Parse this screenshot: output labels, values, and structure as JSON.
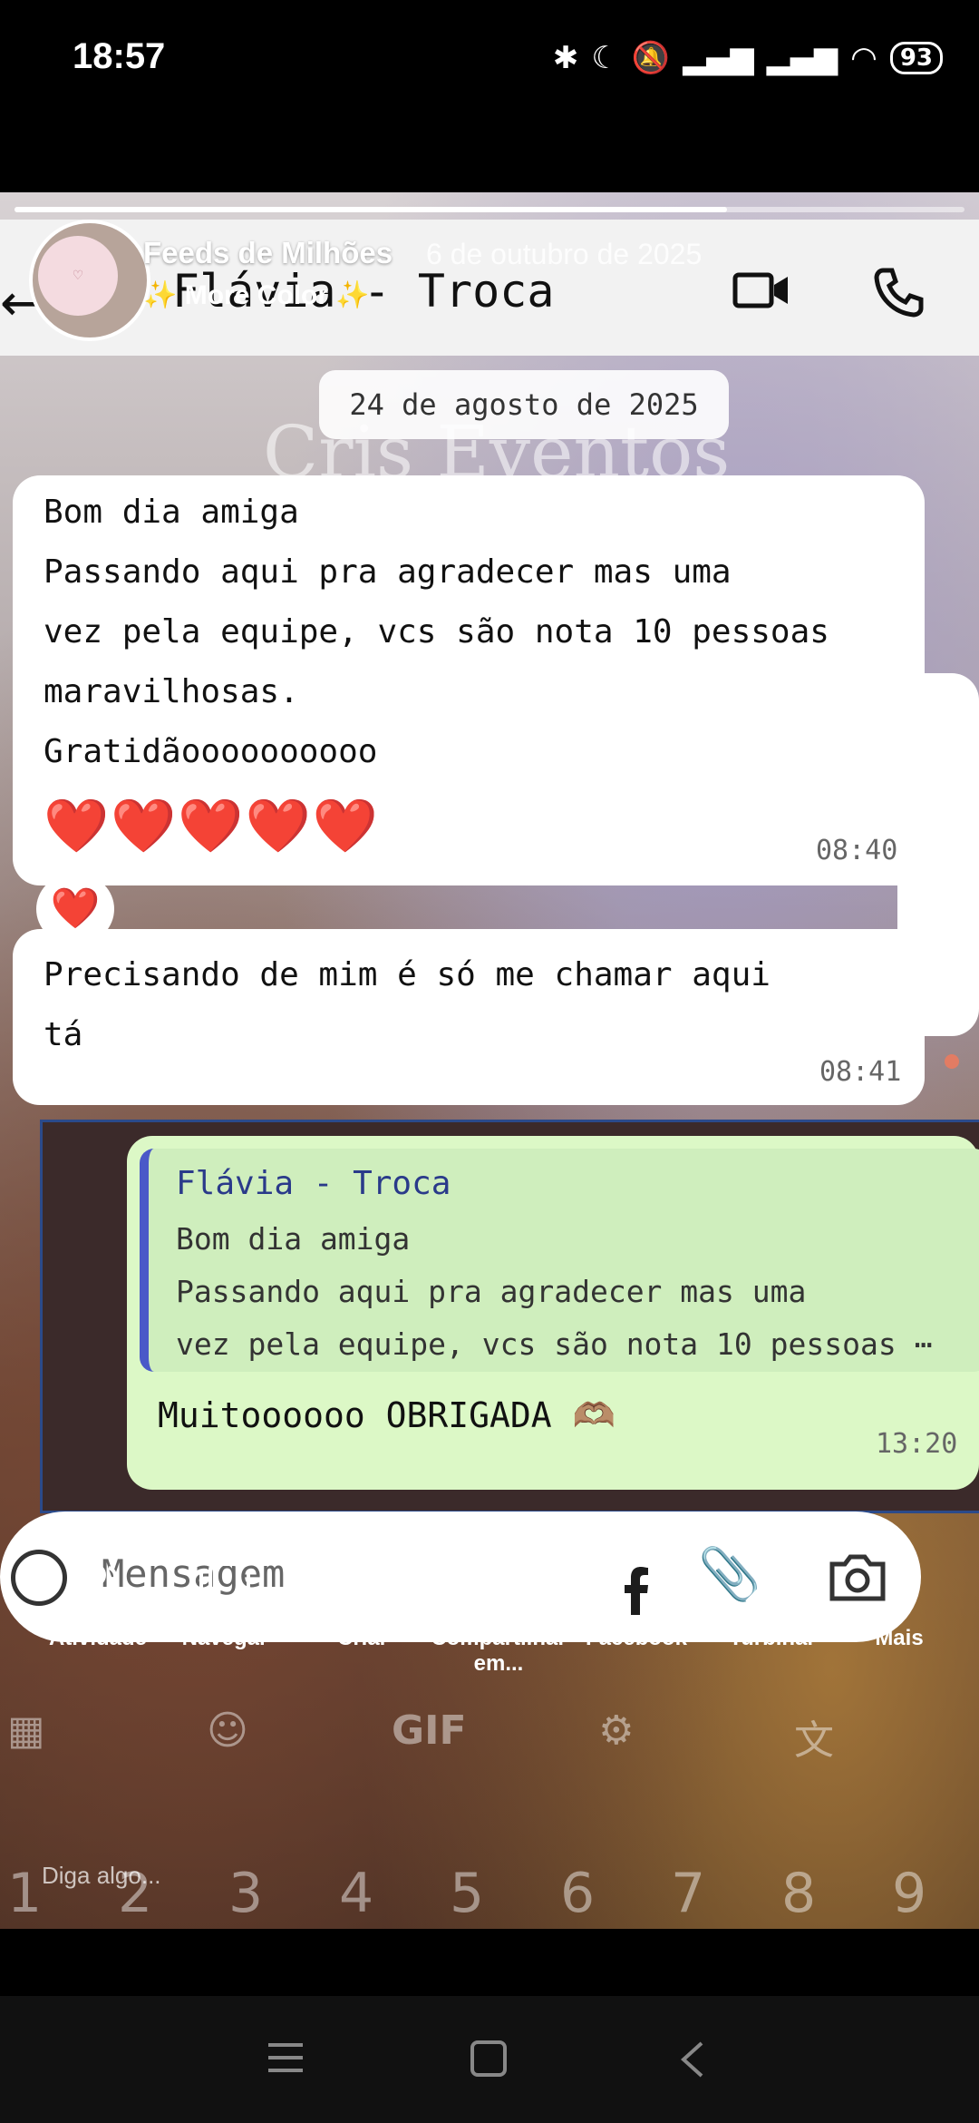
{
  "status_bar": {
    "time": "18:57",
    "battery": "93"
  },
  "story": {
    "user": "Feeds de Milhões",
    "date": "6 de outubro de 2025",
    "music": "More Color ✨",
    "progress": 0.75
  },
  "chat": {
    "contact_name": "Flávia - Troca",
    "date_chip": "24 de agosto de 2025",
    "background_title": "Cris Eventos",
    "message1": {
      "lines": [
        "Bom dia amiga",
        "Passando aqui pra agradecer mas uma",
        "vez pela equipe, vcs são nota 10 pessoas",
        "maravilhosas.",
        "Gratidãoooooooooo"
      ],
      "hearts": "❤️❤️❤️❤️❤️",
      "time": "08:40",
      "reaction": "❤️"
    },
    "message2": {
      "lines": [
        "Precisando de mim é só me chamar aqui",
        "tá"
      ],
      "time": "08:41"
    },
    "message3": {
      "quote_author": "Flávia - Troca",
      "quote_lines": [
        "Bom dia amiga",
        "Passando aqui pra agradecer mas uma",
        "vez pela equipe, vcs são nota 10 pessoas ⋯"
      ],
      "text": "Muitoooooo OBRIGADA 🫶🏽",
      "time": "13:20"
    },
    "input_placeholder": "Mensagem"
  },
  "keyboard": {
    "top": [
      "GIF"
    ],
    "numbers": [
      "1",
      "2",
      "3",
      "4",
      "5",
      "6",
      "7",
      "8",
      "9"
    ]
  },
  "actions": [
    {
      "label": "Atividade",
      "icon": "people-icon"
    },
    {
      "label": "Navegar",
      "icon": "swipe-icon"
    },
    {
      "label": "Criar",
      "icon": "play-icon"
    },
    {
      "label": "Compartilhar em...",
      "icon": "share-icon"
    },
    {
      "label": "Facebook",
      "icon": "facebook-icon"
    },
    {
      "label": "Turbinar",
      "icon": "trending-icon"
    },
    {
      "label": "Mais",
      "icon": "more-vertical-icon"
    }
  ],
  "reply_hint": "Diga algo...",
  "colors": {
    "chat_bubble_out": "#dcf8c6",
    "quote_bar": "#4a59c8",
    "heart": "#e0182d"
  }
}
